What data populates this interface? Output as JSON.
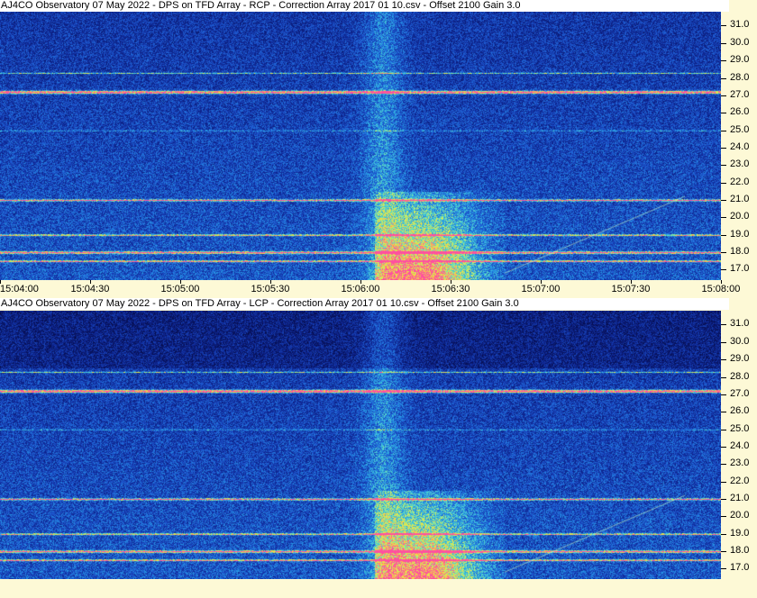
{
  "colors": {
    "background_dark": "#0a1a5c",
    "background_mid": "#1e4fb0",
    "burst_cyan": "#2fa9d6",
    "burst_yellow": "#e8e84a",
    "interference_band": "#f0e060",
    "interference_pink": "#ff3fa0",
    "axis_bg": "#fdf9d6"
  },
  "chart_data": [
    {
      "type": "heatmap",
      "title": "AJ4CO Observatory 07 May 2022  -  DPS on TFD Array  -  RCP  -  Correction Array 2017 01 10.csv  -  Offset 2100  Gain 3.0",
      "y_ticks": [
        "31.0",
        "30.0",
        "29.0",
        "28.0",
        "27.0",
        "26.0",
        "25.0",
        "24.0",
        "23.0",
        "22.0",
        "21.0",
        "20.0",
        "19.0",
        "18.0",
        "17.0"
      ],
      "ylim": [
        16.4,
        31.8
      ],
      "x_ticks": [
        "15:04:00",
        "15:04:30",
        "15:05:00",
        "15:05:30",
        "15:06:00",
        "15:06:30",
        "15:07:00",
        "15:07:30",
        "15:08:00"
      ],
      "xlim": [
        "15:04:00",
        "15:08:00"
      ]
    },
    {
      "type": "heatmap",
      "title": "AJ4CO Observatory 07 May 2022  -  DPS on TFD Array  -  LCP  -  Correction Array 2017 01 10.csv  -  Offset 2100  Gain 3.0",
      "y_ticks": [
        "31.0",
        "30.0",
        "29.0",
        "28.0",
        "27.0",
        "26.0",
        "25.0",
        "24.0",
        "23.0",
        "22.0",
        "21.0",
        "20.0",
        "19.0",
        "18.0",
        "17.0"
      ],
      "ylim": [
        16.4,
        31.8
      ],
      "x_ticks": [],
      "xlim": [
        "15:04:00",
        "15:08:00"
      ]
    }
  ]
}
